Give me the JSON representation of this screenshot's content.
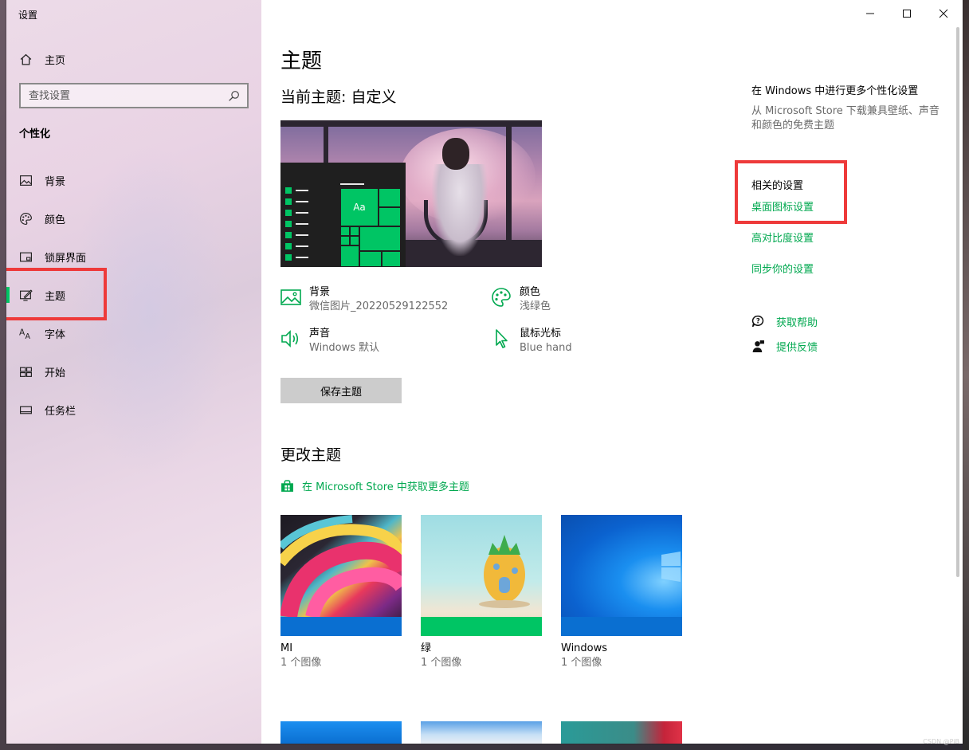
{
  "window": {
    "title": "设置",
    "controls": [
      "minimize",
      "maximize",
      "close"
    ]
  },
  "sidebar": {
    "home_label": "主页",
    "search_placeholder": "查找设置",
    "section_title": "个性化",
    "items": [
      {
        "label": "背景",
        "icon": "picture-icon"
      },
      {
        "label": "颜色",
        "icon": "palette-icon"
      },
      {
        "label": "锁屏界面",
        "icon": "lock-screen-icon"
      },
      {
        "label": "主题",
        "icon": "theme-icon",
        "active": true
      },
      {
        "label": "字体",
        "icon": "font-icon"
      },
      {
        "label": "开始",
        "icon": "start-icon"
      },
      {
        "label": "任务栏",
        "icon": "taskbar-icon"
      }
    ]
  },
  "main": {
    "page_title": "主题",
    "current_theme": "当前主题: 自定义",
    "preview_tile_text": "Aa",
    "properties": {
      "background": {
        "title": "背景",
        "value": "微信图片_20220529122552"
      },
      "color": {
        "title": "颜色",
        "value": "浅绿色"
      },
      "sound": {
        "title": "声音",
        "value": "Windows 默认"
      },
      "cursor": {
        "title": "鼠标光标",
        "value": "Blue hand"
      }
    },
    "save_button": "保存主题",
    "change_theme_title": "更改主题",
    "store_link": "在 Microsoft Store 中获取更多主题",
    "themes": [
      {
        "name": "MI",
        "count": "1 个图像",
        "band_color": "#0a6fd1"
      },
      {
        "name": "绿",
        "count": "1 个图像",
        "band_color": "#00c564"
      },
      {
        "name": "Windows",
        "count": "1 个图像",
        "band_color": "#0a6fd1"
      }
    ]
  },
  "right": {
    "more_title": "在 Windows 中进行更多个性化设置",
    "more_desc": "从 Microsoft Store 下载兼具壁纸、声音和颜色的免费主题",
    "related_title": "相关的设置",
    "links": [
      "桌面图标设置",
      "高对比度设置",
      "同步你的设置"
    ],
    "help": "获取帮助",
    "feedback": "提供反馈"
  },
  "watermark": "CSDN @PiB",
  "colors": {
    "accent": "#00c564",
    "link": "#00a84f",
    "highlight_box": "#ee3a3a"
  }
}
